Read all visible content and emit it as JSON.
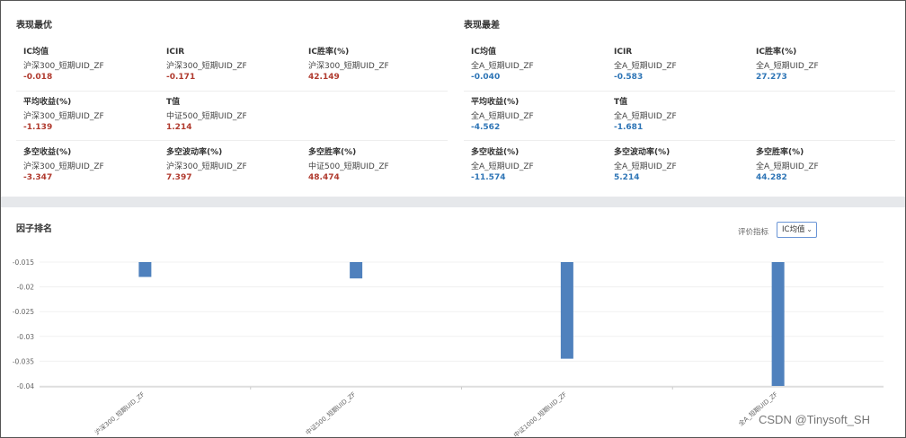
{
  "best": {
    "title": "表现最优",
    "metrics": [
      {
        "label": "IC均值",
        "name": "沪深300_短期UID_ZF",
        "value": "-0.018"
      },
      {
        "label": "ICIR",
        "name": "沪深300_短期UID_ZF",
        "value": "-0.171"
      },
      {
        "label": "IC胜率(%)",
        "name": "沪深300_短期UID_ZF",
        "value": "42.149"
      },
      {
        "label": "平均收益(%)",
        "name": "沪深300_短期UID_ZF",
        "value": "-1.139"
      },
      {
        "label": "T值",
        "name": "中证500_短期UID_ZF",
        "value": "1.214"
      },
      {
        "label": "多空收益(%)",
        "name": "沪深300_短期UID_ZF",
        "value": "-3.347"
      },
      {
        "label": "多空波动率(%)",
        "name": "沪深300_短期UID_ZF",
        "value": "7.397"
      },
      {
        "label": "多空胜率(%)",
        "name": "中证500_短期UID_ZF",
        "value": "48.474"
      }
    ]
  },
  "worst": {
    "title": "表现最差",
    "metrics": [
      {
        "label": "IC均值",
        "name": "全A_短期UID_ZF",
        "value": "-0.040"
      },
      {
        "label": "ICIR",
        "name": "全A_短期UID_ZF",
        "value": "-0.583"
      },
      {
        "label": "IC胜率(%)",
        "name": "全A_短期UID_ZF",
        "value": "27.273"
      },
      {
        "label": "平均收益(%)",
        "name": "全A_短期UID_ZF",
        "value": "-4.562"
      },
      {
        "label": "T值",
        "name": "全A_短期UID_ZF",
        "value": "-1.681"
      },
      {
        "label": "多空收益(%)",
        "name": "全A_短期UID_ZF",
        "value": "-11.574"
      },
      {
        "label": "多空波动率(%)",
        "name": "全A_短期UID_ZF",
        "value": "5.214"
      },
      {
        "label": "多空胜率(%)",
        "name": "全A_短期UID_ZF",
        "value": "44.282"
      }
    ]
  },
  "ranking": {
    "title": "因子排名",
    "indicator_label": "评价指标",
    "indicator_value": "IC均值"
  },
  "colors": {
    "best_value": "#b03a2e",
    "worst_value": "#2e75b6",
    "bar": "#4f81bd"
  },
  "watermark": "CSDN @Tinysoft_SH",
  "chart_data": {
    "type": "bar",
    "categories": [
      "沪深300_短期UID_ZF",
      "中证500_短期UID_ZF",
      "中证1000_短期UID_ZF",
      "全A_短期UID_ZF"
    ],
    "values": [
      -0.018,
      -0.0183,
      -0.0345,
      -0.04
    ],
    "yticks": [
      "-0.015",
      "-0.02",
      "-0.025",
      "-0.03",
      "-0.035",
      "-0.04"
    ],
    "ylim": [
      -0.04,
      -0.015
    ],
    "title": "",
    "xlabel": "",
    "ylabel": ""
  }
}
